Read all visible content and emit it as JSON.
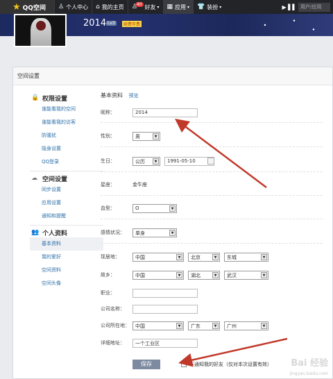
{
  "nav": {
    "logo": "QQ空间",
    "items": [
      {
        "label": "个人中心",
        "icon": "person-icon"
      },
      {
        "label": "我的主页",
        "icon": "home-icon"
      },
      {
        "label": "好友",
        "icon": "friends-icon",
        "badge": "40"
      },
      {
        "label": "应用",
        "icon": "apps-icon"
      },
      {
        "label": "装扮",
        "icon": "shirt-icon"
      }
    ],
    "search_placeholder": "用户/应用"
  },
  "profile": {
    "year": "2014",
    "level": "Lv3",
    "vip": "续费年费"
  },
  "panel_title": "空间设置",
  "sidebar": {
    "sections": [
      {
        "title": "权限设置",
        "icon": "lock-icon",
        "items": [
          "谁能看我的空间",
          "谁能看我的访客",
          "防骚扰",
          "隐身设置",
          "QQ登录"
        ]
      },
      {
        "title": "空间设置",
        "icon": "cloud-icon",
        "items": [
          "同步设置",
          "应用设置",
          "通知和提醒"
        ]
      },
      {
        "title": "个人资料",
        "icon": "people-icon",
        "items": [
          "基本资料",
          "我的爱好",
          "空间资料",
          "空间头像"
        ]
      }
    ],
    "active_item": "基本资料"
  },
  "form": {
    "title": "基本资料",
    "preview": "预览",
    "nickname_label": "昵称：",
    "nickname_value": "2014",
    "gender_label": "性别：",
    "gender_value": "男",
    "birthday_label": "生日：",
    "calendar_value": "公历",
    "birthday_value": "1991-05-10",
    "zodiac_label": "星座：",
    "zodiac_value": "金牛座",
    "blood_label": "血型：",
    "blood_value": "O",
    "relationship_label": "感情状况：",
    "relationship_value": "单身",
    "residence_label": "现居地：",
    "residence": [
      "中国",
      "北京",
      "东城"
    ],
    "hometown_label": "故乡：",
    "hometown": [
      "中国",
      "湖北",
      "武汉"
    ],
    "job_label": "职业：",
    "company_label": "公司名称：",
    "company_loc_label": "公司所在地：",
    "company_loc": [
      "中国",
      "广东",
      "广州"
    ],
    "address_label": "详细地址：",
    "address_value": "一个工业区",
    "save_label": "保存",
    "notify_label": "不通知我的好友（仅对本次设置有效）"
  },
  "watermark": "Bai 经验",
  "watermark_url": "jingyan.baidu.com",
  "colors": {
    "accent_arrow": "#c0392b",
    "link": "#2d6fa8",
    "nav_bg": "#222428"
  }
}
